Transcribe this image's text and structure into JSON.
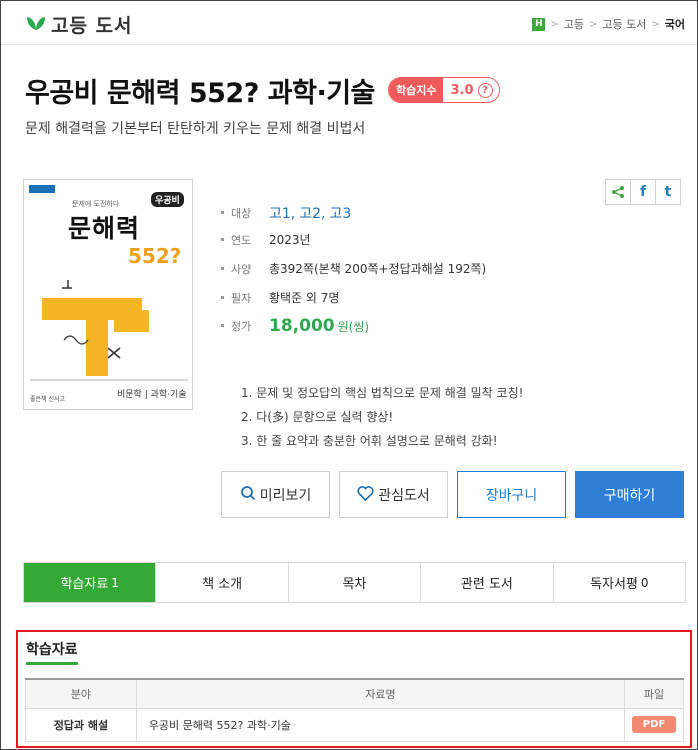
{
  "header": {
    "logo_text": "고등 도서",
    "breadcrumb": {
      "badge": "H",
      "items": [
        "고등",
        "고등 도서",
        "국어"
      ]
    }
  },
  "book": {
    "title": "우공비 문해력 552? 과학·기술",
    "study_index": {
      "label": "학습지수",
      "value": "3.0",
      "help": "?"
    },
    "subtitle": "문제 해결력을 기본부터 탄탄하게 키우는 문제 해결 비법서",
    "cover": {
      "brand": "우공비",
      "tagline": "문제에 도전하다",
      "title": "문해력",
      "number": "552?",
      "footer": "비문학 | 과학·기술",
      "publisher": "좋은책 신사고"
    },
    "info": {
      "target_label": "대상",
      "targets": [
        "고1,",
        "고2,",
        "고3"
      ],
      "year_label": "연도",
      "year": "2023년",
      "spec_label": "사양",
      "spec": "총392쪽(본책 200쪽+정답과해설 192쪽)",
      "author_label": "필자",
      "author": "황택준 외 7명",
      "price_label": "정가",
      "price": "18,000",
      "price_unit": "원(씽)"
    },
    "features": [
      "1. 문제 및 정오답의 핵심 법칙으로 문제 해결 밀착 코칭!",
      "2. 다(多) 문항으로 실력 향상!",
      "3. 한 줄 요약과 충분한 어휘 설명으로 문해력 강화!"
    ]
  },
  "share": {
    "icons": [
      "share-icon",
      "facebook-icon",
      "twitter-icon"
    ],
    "facebook": "f",
    "twitter": "t"
  },
  "actions": {
    "preview": "미리보기",
    "wishlist": "관심도서",
    "cart": "장바구니",
    "buy": "구매하기"
  },
  "tabs": [
    {
      "label": "학습자료",
      "count": "1"
    },
    {
      "label": "책 소개"
    },
    {
      "label": "목차"
    },
    {
      "label": "관련 도서"
    },
    {
      "label": "독자서평",
      "count": "0"
    }
  ],
  "resources": {
    "title": "학습자료",
    "headers": [
      "분야",
      "자료명",
      "파일"
    ],
    "rows": [
      {
        "category": "정답과 해설",
        "name": "우공비 문해력 552? 과학·기술",
        "file": "PDF"
      }
    ]
  },
  "colors": {
    "green": "#35a935",
    "blue": "#2f7fd6",
    "red": "#f05a5a",
    "pdf": "#f58a72",
    "highlight": "#e21a1a"
  }
}
